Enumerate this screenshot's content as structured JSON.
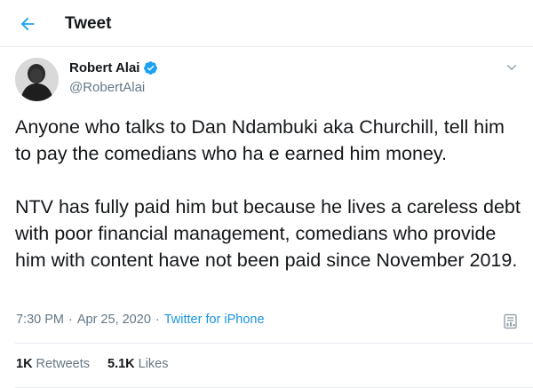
{
  "header": {
    "title": "Tweet",
    "back_icon": "arrow-left-icon",
    "accent": "#1da1f2"
  },
  "author": {
    "display_name": "Robert Alai",
    "handle": "@RobertAlai",
    "verified": true,
    "avatar_icon": "avatar"
  },
  "tweet": {
    "paragraphs": [
      "Anyone who talks to Dan Ndambuki aka Churchill, tell him to pay the comedians who ha e earned him money.",
      "NTV has fully paid him but because he lives a careless debt with poor financial management, comedians who provide him with content have not been paid since November 2019."
    ],
    "time": "7:30 PM",
    "separator": "·",
    "date": "Apr 25, 2020",
    "source": "Twitter for iPhone"
  },
  "stats": {
    "retweets_count": "1K",
    "retweets_label": "Retweets",
    "likes_count": "5.1K",
    "likes_label": "Likes"
  },
  "colors": {
    "link": "#1b95e0",
    "secondary_text": "#657786",
    "border": "#e6ecf0"
  }
}
